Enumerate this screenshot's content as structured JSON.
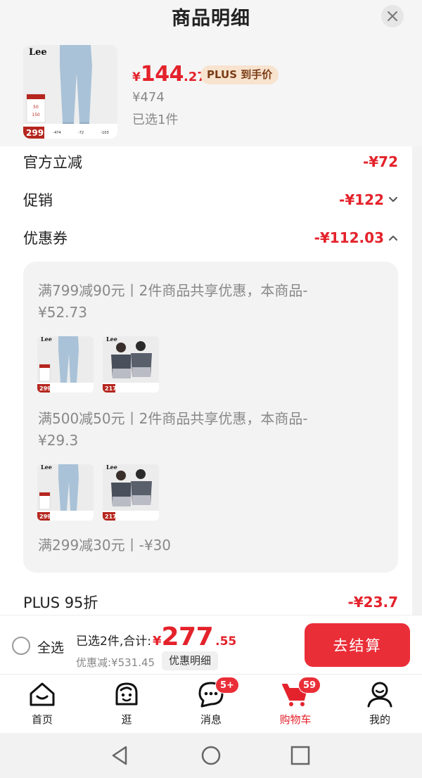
{
  "header": {
    "title": "商品明细"
  },
  "product": {
    "image_icon": "jeans-product-image",
    "brand_logo": "Lee",
    "thumb_price": "299",
    "price_currency": "¥",
    "price_int": "144",
    "price_dec": ".27",
    "plus_badge": "PLUS 到手价",
    "original_price": "¥474",
    "selected": "已选1件"
  },
  "details": {
    "official": {
      "label": "官方立减",
      "value": "-¥72"
    },
    "promo": {
      "label": "促销",
      "value": "-¥122"
    },
    "coupon": {
      "label": "优惠券",
      "value": "-¥112.03"
    },
    "coupons": [
      {
        "text": "满799减90元丨2件商品共享优惠，本商品-¥52.73",
        "thumb_prices": [
          "299",
          "217"
        ]
      },
      {
        "text": "满500减50元丨2件商品共享优惠，本商品-¥29.3",
        "thumb_prices": [
          "299",
          "217"
        ]
      },
      {
        "text": "满299减30元丨-¥30"
      }
    ],
    "plus": {
      "label": "PLUS 95折",
      "value": "-¥23.7"
    }
  },
  "checkout": {
    "select_all": "全选",
    "summary_prefix": "已选2件,合计:",
    "total_currency": "¥",
    "total_int": "277",
    "total_dec": ".55",
    "discount_text": "优惠减:¥531.45",
    "detail_button": "优惠明细",
    "checkout_button": "去结算"
  },
  "bottom_nav": [
    {
      "label": "首页",
      "icon": "home-icon"
    },
    {
      "label": "逛",
      "icon": "browse-icon"
    },
    {
      "label": "消息",
      "icon": "message-icon",
      "badge": "5+"
    },
    {
      "label": "购物车",
      "icon": "cart-icon",
      "badge": "59",
      "active": true
    },
    {
      "label": "我的",
      "icon": "profile-icon"
    }
  ],
  "colors": {
    "accent": "#e4222b",
    "button": "#ea2e38",
    "plus_badge_bg": "#f8e3cf"
  }
}
